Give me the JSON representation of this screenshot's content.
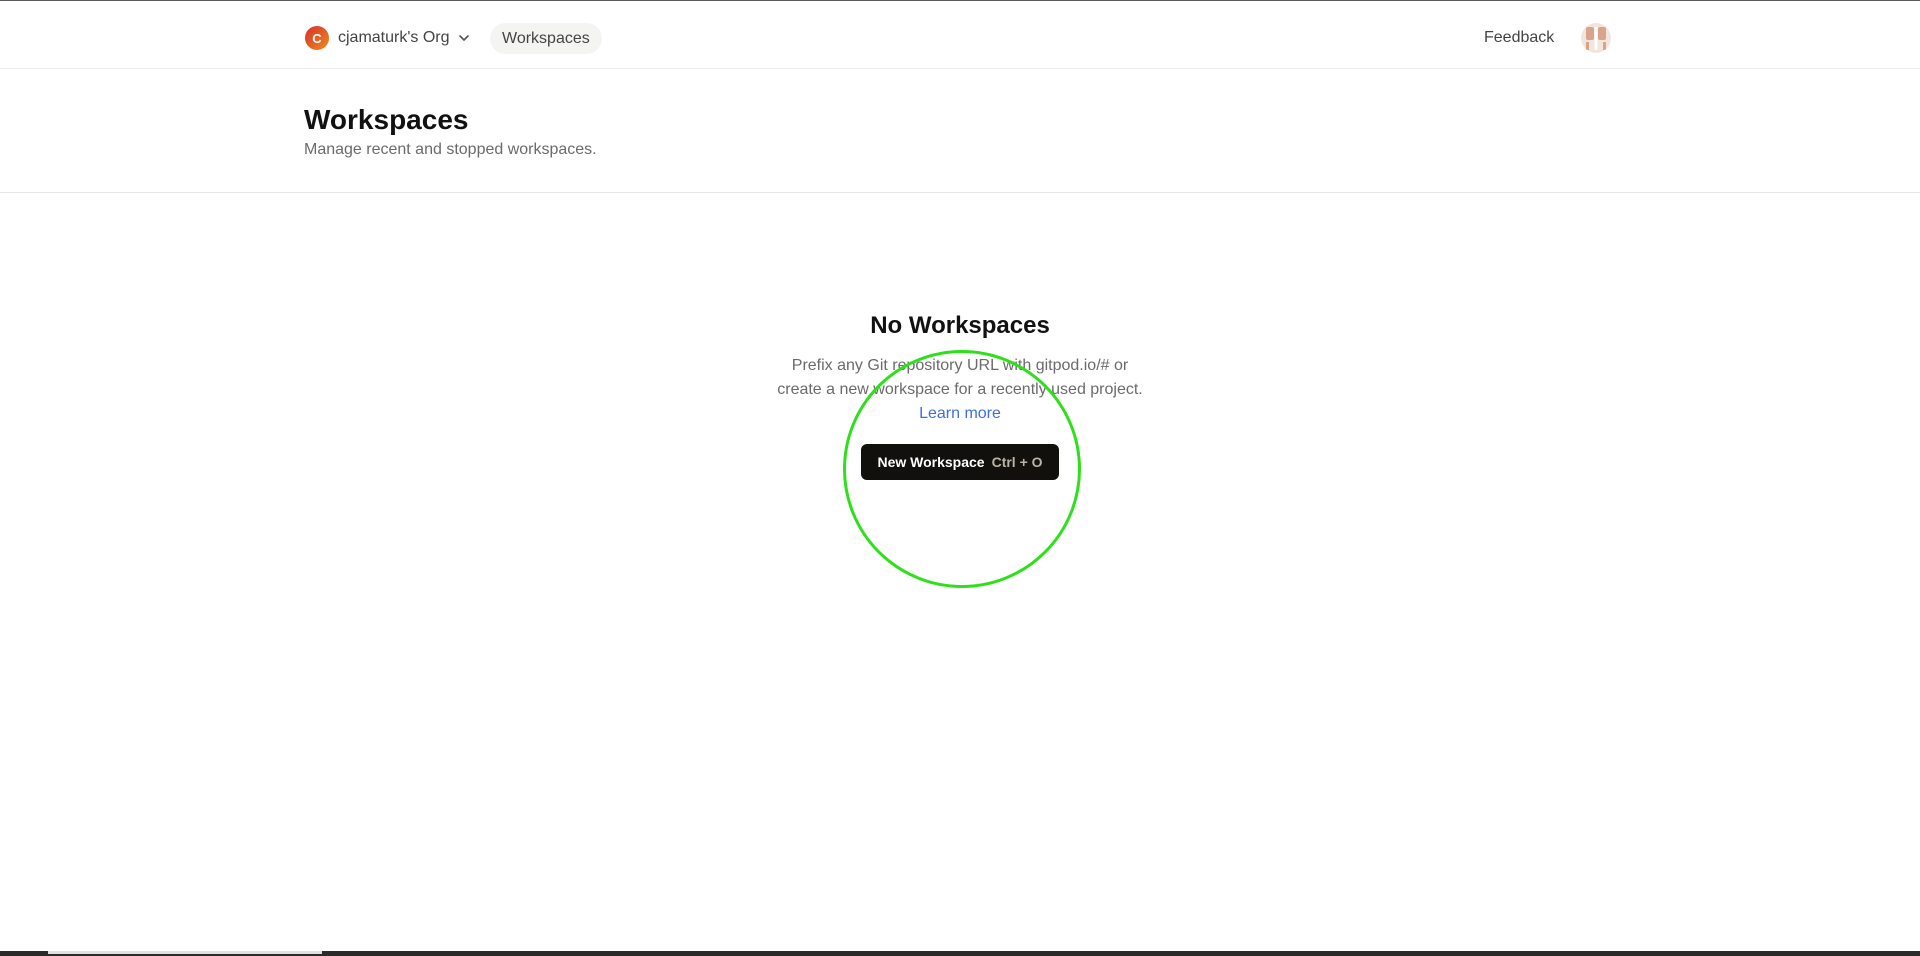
{
  "header": {
    "org": {
      "avatar_letter": "C",
      "name": "cjamaturk's Org"
    },
    "nav_tab": "Workspaces",
    "feedback": "Feedback"
  },
  "page": {
    "title": "Workspaces",
    "subtitle": "Manage recent and stopped workspaces."
  },
  "empty_state": {
    "title": "No Workspaces",
    "description_line1": "Prefix any Git repository URL with gitpod.io/# or",
    "description_line2": "create a new workspace for a recently used project.",
    "learn_more": "Learn more",
    "button_label": "New Workspace",
    "button_shortcut": "Ctrl + O"
  },
  "colors": {
    "accent_link": "#3f6fe0",
    "button_bg": "#12100c",
    "highlight_ring": "#2ee01a"
  },
  "icons": {
    "org_chevron": "chevron-down-icon",
    "user_avatar": "user-avatar-icon"
  }
}
